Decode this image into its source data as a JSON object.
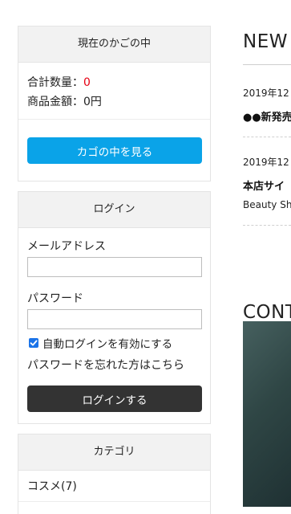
{
  "cart": {
    "title": "現在のかごの中",
    "qty_label": "合計数量：",
    "qty_value": "0",
    "amount_label": "商品金額：",
    "amount_value": "0円",
    "view_button": "カゴの中を見る"
  },
  "login": {
    "title": "ログイン",
    "email_label": "メールアドレス",
    "email_value": "",
    "password_label": "パスワード",
    "password_value": "",
    "auto_login_label": "自動ログインを有効にする",
    "auto_login_checked": true,
    "forgot_link": "パスワードを忘れた方はこちら",
    "submit_button": "ログインする"
  },
  "category": {
    "title": "カテゴリ",
    "items": [
      {
        "label": "コスメ(7)"
      }
    ]
  },
  "news": {
    "title": "NEW",
    "items": [
      {
        "date": "2019年12",
        "headline": "●●新発売"
      },
      {
        "date": "2019年12",
        "headline": "本店サイ",
        "body": "Beauty Sh"
      }
    ]
  },
  "contents": {
    "title": "CONT"
  },
  "colors": {
    "accent_blue": "#0aa3e8",
    "dark_button": "#333333",
    "qty_red": "#e60012"
  }
}
